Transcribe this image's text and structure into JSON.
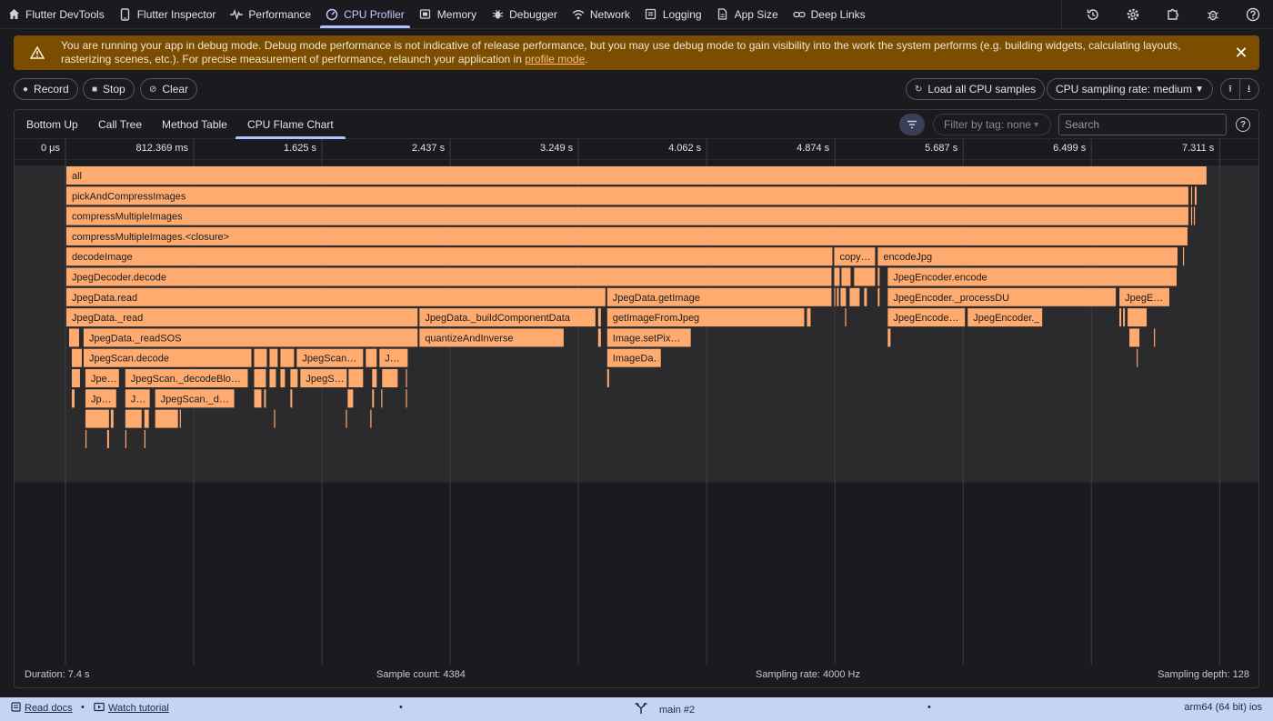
{
  "nav": {
    "tabs": [
      {
        "label": "Flutter DevTools",
        "icon": "home-icon"
      },
      {
        "label": "Flutter Inspector",
        "icon": "phone-icon"
      },
      {
        "label": "Performance",
        "icon": "pulse-icon"
      },
      {
        "label": "CPU Profiler",
        "icon": "gauge-icon"
      },
      {
        "label": "Memory",
        "icon": "memory-icon"
      },
      {
        "label": "Debugger",
        "icon": "bug-icon"
      },
      {
        "label": "Network",
        "icon": "wifi-icon"
      },
      {
        "label": "Logging",
        "icon": "log-icon"
      },
      {
        "label": "App Size",
        "icon": "file-icon"
      },
      {
        "label": "Deep Links",
        "icon": "link-icon"
      }
    ],
    "active": "CPU Profiler"
  },
  "banner": {
    "message": "You are running your app in debug mode. Debug mode performance is not indicative of release performance, but you may use debug mode to gain visibility into the work the system performs (e.g. building widgets, calculating layouts, rasterizing scenes, etc.). For precise measurement of performance, relaunch your application in ",
    "link_text": "profile mode",
    "suffix": "."
  },
  "toolbar": {
    "record": "Record",
    "stop": "Stop",
    "clear": "Clear",
    "load_all": "Load all CPU samples",
    "sampling_rate": "CPU sampling rate: medium"
  },
  "subtabs": [
    "Bottom Up",
    "Call Tree",
    "Method Table",
    "CPU Flame Chart"
  ],
  "active_subtab": "CPU Flame Chart",
  "filter": {
    "tag_placeholder": "Filter by tag: none",
    "search_placeholder": "Search"
  },
  "timeline": {
    "ticks": [
      "0 μs",
      "812.369 ms",
      "1.625 s",
      "2.437 s",
      "3.249 s",
      "4.062 s",
      "4.874 s",
      "5.687 s",
      "6.499 s",
      "7.311 s"
    ],
    "total_s": 7.4
  },
  "flame_frames": [
    {
      "name": "all",
      "d": 0,
      "s": 0,
      "e": 7.2286
    },
    {
      "name": "pickAndCompressImages",
      "d": 1,
      "s": 0,
      "e": 7.1137
    },
    {
      "name": "",
      "d": 1,
      "s": 7.1251,
      "e": 7.1366
    },
    {
      "name": "",
      "d": 1,
      "s": 7.1481,
      "e": 7.1654
    },
    {
      "name": "compressMultipleImages",
      "d": 2,
      "s": 0,
      "e": 7.1137
    },
    {
      "name": "",
      "d": 2,
      "s": 7.1251,
      "e": 7.1309
    },
    {
      "name": "",
      "d": 2,
      "s": 7.1424,
      "e": 7.1481
    },
    {
      "name": "compressMultipleImages.<closure>",
      "d": 3,
      "s": 0,
      "e": 7.108
    },
    {
      "name": "decodeImage",
      "d": 4,
      "s": 0,
      "e": 4.8585
    },
    {
      "name": "copy…",
      "d": 4,
      "s": 4.8643,
      "e": 5.1288
    },
    {
      "name": "encodeJpg",
      "d": 4,
      "s": 5.1403,
      "e": 7.0448
    },
    {
      "name": "",
      "d": 4,
      "s": 7.0735,
      "e": 7.0793
    },
    {
      "name": "JpegDecoder.decode",
      "d": 5,
      "s": 0,
      "e": 4.8528
    },
    {
      "name": "",
      "d": 5,
      "s": 4.8643,
      "e": 4.9045
    },
    {
      "name": "",
      "d": 5,
      "s": 4.9103,
      "e": 4.9735
    },
    {
      "name": "",
      "d": 5,
      "s": 4.9907,
      "e": 5.1288
    },
    {
      "name": "",
      "d": 5,
      "s": 5.1403,
      "e": 5.1575
    },
    {
      "name": "JpegEncoder.encode",
      "d": 5,
      "s": 5.2035,
      "e": 7.0391
    },
    {
      "name": "JpegData.read",
      "d": 6,
      "s": 0,
      "e": 3.4206
    },
    {
      "name": "JpegData.getImage",
      "d": 6,
      "s": 3.4263,
      "e": 4.8528
    },
    {
      "name": "",
      "d": 6,
      "s": 4.8643,
      "e": 4.8758
    },
    {
      "name": "",
      "d": 6,
      "s": 4.8815,
      "e": 4.8988
    },
    {
      "name": "",
      "d": 6,
      "s": 4.9045,
      "e": 4.9447
    },
    {
      "name": "",
      "d": 6,
      "s": 4.9619,
      "e": 5.0309
    },
    {
      "name": "",
      "d": 6,
      "s": 5.0539,
      "e": 5.0769
    },
    {
      "name": "",
      "d": 6,
      "s": 5.1403,
      "e": 5.1575
    },
    {
      "name": "JpegEncoder._processDU",
      "d": 6,
      "s": 5.2035,
      "e": 6.6539
    },
    {
      "name": "JpegE…",
      "d": 6,
      "s": 6.6711,
      "e": 6.993
    },
    {
      "name": "JpegData._read",
      "d": 7,
      "s": 0,
      "e": 2.2311
    },
    {
      "name": "JpegData._buildComponentData",
      "d": 7,
      "s": 2.2369,
      "e": 3.3573
    },
    {
      "name": "",
      "d": 7,
      "s": 3.3688,
      "e": 3.3919
    },
    {
      "name": "getImageFromJpeg",
      "d": 7,
      "s": 3.4263,
      "e": 4.6802
    },
    {
      "name": "",
      "d": 7,
      "s": 4.6917,
      "e": 4.7204
    },
    {
      "name": "",
      "d": 7,
      "s": 4.9332,
      "e": 4.9447
    },
    {
      "name": "JpegEncode…",
      "d": 7,
      "s": 5.2035,
      "e": 5.6983
    },
    {
      "name": "JpegEncoder._fD…",
      "d": 7,
      "s": 5.7098,
      "e": 6.1877
    },
    {
      "name": "",
      "d": 7,
      "s": 6.6711,
      "e": 6.6883
    },
    {
      "name": "",
      "d": 7,
      "s": 6.6941,
      "e": 6.7114
    },
    {
      "name": "",
      "d": 7,
      "s": 6.7229,
      "e": 6.8495
    },
    {
      "name": "",
      "d": 8,
      "s": 0.0173,
      "e": 0.0862
    },
    {
      "name": "JpegData._readSOS",
      "d": 8,
      "s": 0.1092,
      "e": 2.2311
    },
    {
      "name": "quantizeAndInverse",
      "d": 8,
      "s": 2.2369,
      "e": 3.156
    },
    {
      "name": "",
      "d": 8,
      "s": 3.3688,
      "e": 3.3919
    },
    {
      "name": "Image.setPix…",
      "d": 8,
      "s": 3.4263,
      "e": 3.9612
    },
    {
      "name": "",
      "d": 8,
      "s": 5.2035,
      "e": 5.2266
    },
    {
      "name": "",
      "d": 8,
      "s": 6.7344,
      "e": 6.8035
    },
    {
      "name": "",
      "d": 8,
      "s": 6.8898,
      "e": 6.9013
    },
    {
      "name": "",
      "d": 9,
      "s": 0.0345,
      "e": 0.1034
    },
    {
      "name": "JpegScan.decode",
      "d": 9,
      "s": 0.1092,
      "e": 1.1779
    },
    {
      "name": "",
      "d": 9,
      "s": 1.1894,
      "e": 1.2756
    },
    {
      "name": "",
      "d": 9,
      "s": 1.2871,
      "e": 1.3445
    },
    {
      "name": "",
      "d": 9,
      "s": 1.356,
      "e": 1.4479
    },
    {
      "name": "JpegScan…",
      "d": 9,
      "s": 1.4594,
      "e": 1.8855
    },
    {
      "name": "",
      "d": 9,
      "s": 1.897,
      "e": 1.9717
    },
    {
      "name": "J…",
      "d": 9,
      "s": 1.9832,
      "e": 2.1679
    },
    {
      "name": "ImageDa…",
      "d": 9,
      "s": 3.4263,
      "e": 3.7715
    },
    {
      "name": "",
      "d": 9,
      "s": 6.7804,
      "e": 6.7919
    },
    {
      "name": "",
      "d": 10,
      "s": 0.0345,
      "e": 0.0919
    },
    {
      "name": "Jpe…",
      "d": 10,
      "s": 0.1207,
      "e": 0.3387
    },
    {
      "name": "JpegScan._decodeBlo…",
      "d": 10,
      "s": 0.3733,
      "e": 1.1549
    },
    {
      "name": "",
      "d": 10,
      "s": 1.1894,
      "e": 1.2698
    },
    {
      "name": "",
      "d": 10,
      "s": 1.2871,
      "e": 1.333
    },
    {
      "name": "",
      "d": 10,
      "s": 1.356,
      "e": 1.3905
    },
    {
      "name": "",
      "d": 10,
      "s": 1.4192,
      "e": 1.4709
    },
    {
      "name": "JpegS…",
      "d": 10,
      "s": 1.4824,
      "e": 1.782
    },
    {
      "name": "",
      "d": 10,
      "s": 1.7877,
      "e": 1.8855
    },
    {
      "name": "",
      "d": 10,
      "s": 1.9372,
      "e": 1.9717
    },
    {
      "name": "",
      "d": 10,
      "s": 2.0004,
      "e": 2.1047
    },
    {
      "name": "",
      "d": 10,
      "s": 2.1507,
      "e": 2.1622
    },
    {
      "name": "",
      "d": 10,
      "s": 3.4263,
      "e": 3.4436
    },
    {
      "name": "",
      "d": 11,
      "s": 0.0345,
      "e": 0.0574
    },
    {
      "name": "Jp…",
      "d": 11,
      "s": 0.1207,
      "e": 0.3214
    },
    {
      "name": "J…",
      "d": 11,
      "s": 0.3733,
      "e": 0.5338
    },
    {
      "name": "JpegScan._d…",
      "d": 11,
      "s": 0.5626,
      "e": 1.0689
    },
    {
      "name": "",
      "d": 11,
      "s": 1.1894,
      "e": 1.2411
    },
    {
      "name": "",
      "d": 11,
      "s": 1.2526,
      "e": 1.2698
    },
    {
      "name": "",
      "d": 11,
      "s": 1.4192,
      "e": 1.4364
    },
    {
      "name": "",
      "d": 11,
      "s": 1.782,
      "e": 1.8222
    },
    {
      "name": "",
      "d": 11,
      "s": 1.9372,
      "e": 1.9544
    },
    {
      "name": "",
      "d": 11,
      "s": 1.9947,
      "e": 2.0061
    },
    {
      "name": "",
      "d": 11,
      "s": 2.1507,
      "e": 2.1622
    },
    {
      "name": "",
      "d": 12,
      "s": 0.1207,
      "e": 0.2758
    },
    {
      "name": "",
      "d": 12,
      "s": 0.2816,
      "e": 0.3041
    },
    {
      "name": "",
      "d": 12,
      "s": 0.3733,
      "e": 0.4825
    },
    {
      "name": "",
      "d": 12,
      "s": 0.494,
      "e": 0.528
    },
    {
      "name": "",
      "d": 12,
      "s": 0.5626,
      "e": 0.7127
    },
    {
      "name": "",
      "d": 12,
      "s": 0.7185,
      "e": 0.73
    },
    {
      "name": "",
      "d": 12,
      "s": 1.3158,
      "e": 1.3273
    },
    {
      "name": "",
      "d": 12,
      "s": 1.7705,
      "e": 1.782
    },
    {
      "name": "",
      "d": 12,
      "s": 1.9257,
      "e": 1.9372
    },
    {
      "name": "",
      "d": 13,
      "s": 0.1207,
      "e": 0.1264
    },
    {
      "name": "",
      "d": 13,
      "s": 0.2586,
      "e": 0.2758
    },
    {
      "name": "",
      "d": 13,
      "s": 0.3733,
      "e": 0.379
    },
    {
      "name": "",
      "d": 13,
      "s": 0.494,
      "e": 0.5055
    }
  ],
  "footer": {
    "duration": "Duration: 7.4 s",
    "sample_count": "Sample count: 4384",
    "sampling_rate": "Sampling rate: 4000 Hz",
    "sampling_depth": "Sampling depth: 128"
  },
  "statusbar": {
    "read_docs": "Read docs",
    "watch_tutorial": "Watch tutorial",
    "isolate": "main #2",
    "platform": "arm64 (64 bit) ios"
  },
  "colors": {
    "frame_fill": "#ffab70",
    "frame_text": "#1b1b1f",
    "accent": "#b4c0ff",
    "banner_bg": "#7a4d00",
    "statusbar_bg": "#c3d4f5"
  }
}
